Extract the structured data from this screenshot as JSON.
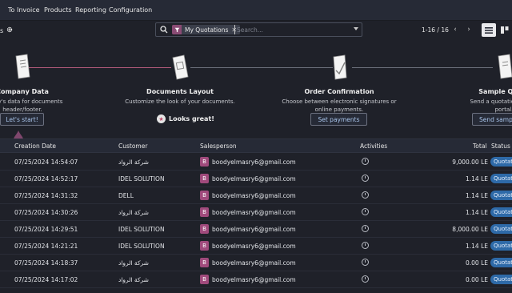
{
  "nav": {
    "items": [
      "To Invoice",
      "Products",
      "Reporting",
      "Configuration"
    ]
  },
  "control": {
    "breadcrumb": "s",
    "search": {
      "facet_label": "My Quotations",
      "placeholder": "Search..."
    },
    "pager": "1-16 / 16"
  },
  "onboarding": {
    "steps": [
      {
        "title": "Company Data",
        "desc1": "mpany's data for documents",
        "desc2": "header/footer.",
        "action": "Let's start!"
      },
      {
        "title": "Documents Layout",
        "desc1": "Customize the look of your documents.",
        "desc2": "",
        "action": "Looks great!"
      },
      {
        "title": "Order Confirmation",
        "desc1": "Choose between electronic signatures or",
        "desc2": "online payments.",
        "action": "Set payments"
      },
      {
        "title": "Sample Quota",
        "desc1": "Send a quotation to test",
        "desc2": "portal.",
        "action": "Send sampl"
      }
    ]
  },
  "table": {
    "headers": {
      "creation_date": "Creation Date",
      "customer": "Customer",
      "salesperson": "Salesperson",
      "activities": "Activities",
      "total": "Total",
      "status": "Status"
    },
    "rows": [
      {
        "date": "07/25/2024 14:54:07",
        "customer": "شركة الرواد",
        "avatar": "B",
        "salesperson": "boodyelmasry6@gmail.com",
        "total": "9,000.00 LE",
        "status": "Quotatio"
      },
      {
        "date": "07/25/2024 14:52:17",
        "customer": "IDEL SOLUTION",
        "avatar": "B",
        "salesperson": "boodyelmasry6@gmail.com",
        "total": "1.14 LE",
        "status": "Quotatio"
      },
      {
        "date": "07/25/2024 14:31:32",
        "customer": "DELL",
        "avatar": "B",
        "salesperson": "boodyelmasry6@gmail.com",
        "total": "1.14 LE",
        "status": "Quotatio"
      },
      {
        "date": "07/25/2024 14:30:26",
        "customer": "شركة الرواد",
        "avatar": "B",
        "salesperson": "boodyelmasry6@gmail.com",
        "total": "1.14 LE",
        "status": "Quotatio"
      },
      {
        "date": "07/25/2024 14:29:51",
        "customer": "IDEL SOLUTION",
        "avatar": "B",
        "salesperson": "boodyelmasry6@gmail.com",
        "total": "8,000.00 LE",
        "status": "Quotatio"
      },
      {
        "date": "07/25/2024 14:21:21",
        "customer": "IDEL SOLUTION",
        "avatar": "B",
        "salesperson": "boodyelmasry6@gmail.com",
        "total": "1.14 LE",
        "status": "Quotatio"
      },
      {
        "date": "07/25/2024 14:18:37",
        "customer": "شركة الرواد",
        "avatar": "B",
        "salesperson": "boodyelmasry6@gmail.com",
        "total": "0.00 LE",
        "status": "Quotatio"
      },
      {
        "date": "07/25/2024 14:17:02",
        "customer": "شركة الرواد",
        "avatar": "B",
        "salesperson": "boodyelmasry6@gmail.com",
        "total": "0.00 LE",
        "status": "Quotatio"
      }
    ]
  }
}
